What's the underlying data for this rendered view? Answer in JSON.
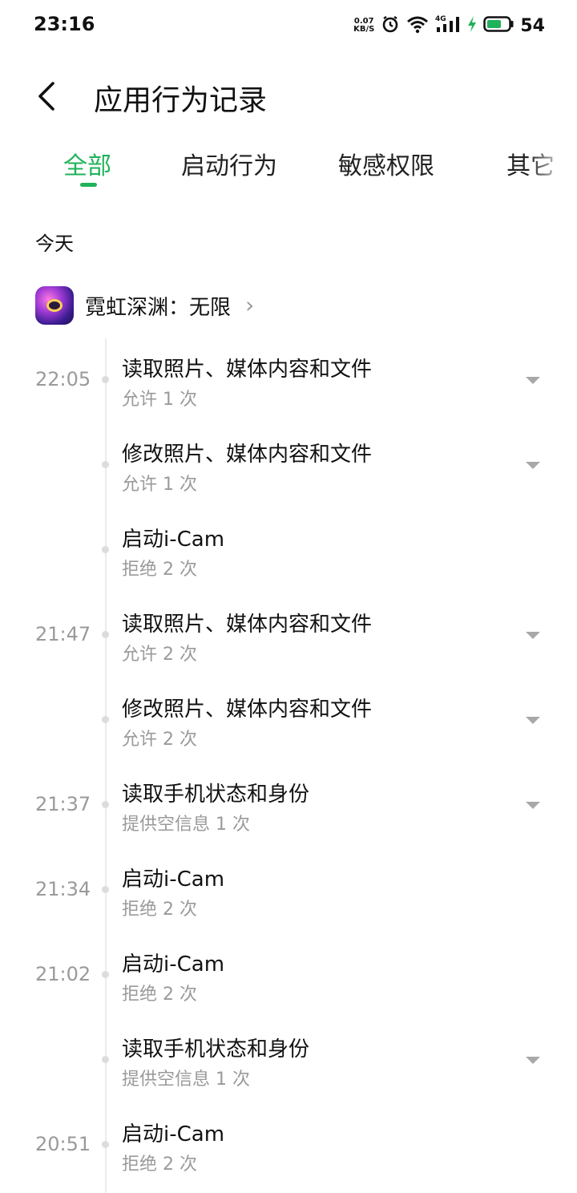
{
  "status_bar": {
    "time": "23:16",
    "net_speed_value": "0.07",
    "net_speed_unit": "KB/S",
    "battery_percent": "54",
    "icons": [
      "alarm-icon",
      "wifi-icon",
      "signal-4g-icon",
      "charging-icon",
      "battery-icon"
    ]
  },
  "header": {
    "title": "应用行为记录"
  },
  "tabs": [
    {
      "label": "全部",
      "active": true
    },
    {
      "label": "启动行为",
      "active": false
    },
    {
      "label": "敏感权限",
      "active": false
    },
    {
      "label": "其它",
      "active": false
    }
  ],
  "section": {
    "title": "今天"
  },
  "app": {
    "name": "霓虹深渊：无限"
  },
  "entries": [
    {
      "time": "22:05",
      "title": "读取照片、媒体内容和文件",
      "subtitle": "允许 1 次",
      "expandable": true
    },
    {
      "time": "",
      "title": "修改照片、媒体内容和文件",
      "subtitle": "允许 1 次",
      "expandable": true
    },
    {
      "time": "",
      "title": "启动i-Cam",
      "subtitle": "拒绝 2 次",
      "expandable": false
    },
    {
      "time": "21:47",
      "title": "读取照片、媒体内容和文件",
      "subtitle": "允许 2 次",
      "expandable": true
    },
    {
      "time": "",
      "title": "修改照片、媒体内容和文件",
      "subtitle": "允许 2 次",
      "expandable": true
    },
    {
      "time": "21:37",
      "title": "读取手机状态和身份",
      "subtitle": "提供空信息 1 次",
      "expandable": true
    },
    {
      "time": "21:34",
      "title": "启动i-Cam",
      "subtitle": "拒绝 2 次",
      "expandable": false
    },
    {
      "time": "21:02",
      "title": "启动i-Cam",
      "subtitle": "拒绝 2 次",
      "expandable": false
    },
    {
      "time": "",
      "title": "读取手机状态和身份",
      "subtitle": "提供空信息 1 次",
      "expandable": true
    },
    {
      "time": "20:51",
      "title": "启动i-Cam",
      "subtitle": "拒绝 2 次",
      "expandable": false
    }
  ],
  "colors": {
    "accent": "#1fb25a",
    "secondary_text": "#9a9a9a"
  }
}
